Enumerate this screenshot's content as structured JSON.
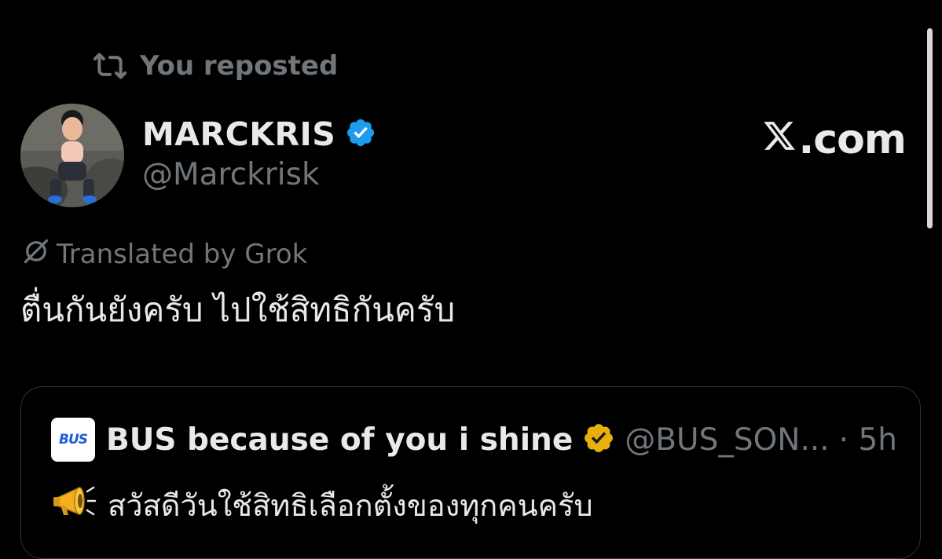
{
  "repost": {
    "label": "You reposted",
    "icon": "repost-icon"
  },
  "author": {
    "display_name": "MARCKRIS",
    "handle": "@Marckrisk",
    "verified_color": "#1d9bf0",
    "avatar": "avatar-photo"
  },
  "brand": {
    "text": ".com",
    "logo": "x-logo-icon"
  },
  "translation": {
    "label": "Translated by Grok",
    "icon": "grok-icon"
  },
  "tweet": {
    "text": "ตื่นกันยังครับ ไปใช้สิทธิกันครับ"
  },
  "quote": {
    "avatar_text": "BUS",
    "display_name": "BUS because of you i shine",
    "verified_color": "#e8b00f",
    "handle": "@BUS_SON...",
    "time": "· 5h",
    "emoji": "megaphone-icon",
    "line1": "สวัสดีวันใช้สิทธิเลือกตั้งของทุกคนครับ",
    "line2": ""
  },
  "colors": {
    "background": "#000000",
    "text_primary": "#e7e9ea",
    "text_secondary": "#71767b",
    "border": "#2f3336"
  }
}
